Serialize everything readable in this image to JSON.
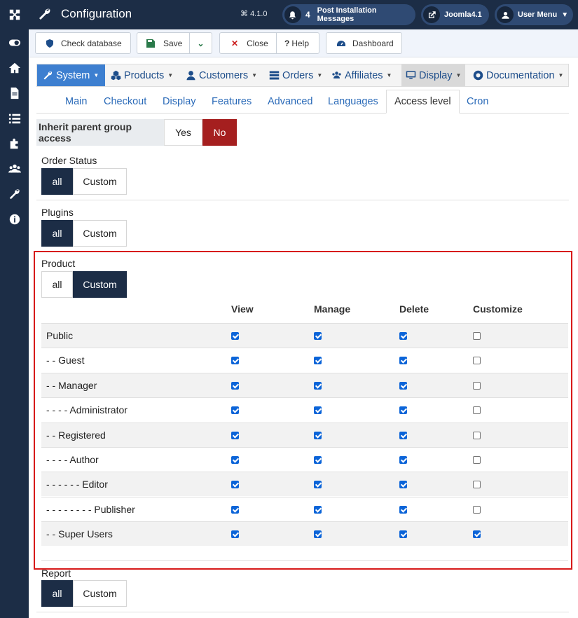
{
  "header": {
    "title": "Configuration",
    "version": "4.1.0",
    "notifications_count": "4",
    "post_install_label": "Post Installation Messages",
    "site_link_label": "Joomla4.1",
    "user_menu_label": "User Menu"
  },
  "toolbar": {
    "check_db": "Check database",
    "save": "Save",
    "close": "Close",
    "help": "Help",
    "dashboard": "Dashboard"
  },
  "menubar": {
    "items": [
      {
        "label": "System",
        "icon": "wrench-icon"
      },
      {
        "label": "Products",
        "icon": "cubes-icon"
      },
      {
        "label": "Customers",
        "icon": "user-icon"
      },
      {
        "label": "Orders",
        "icon": "list-icon"
      },
      {
        "label": "Affiliates",
        "icon": "users-icon"
      },
      {
        "label": "Display",
        "icon": "monitor-icon"
      },
      {
        "label": "Documentation",
        "icon": "lifebuoy-icon"
      }
    ]
  },
  "tabs": [
    "Main",
    "Checkout",
    "Display",
    "Features",
    "Advanced",
    "Languages",
    "Access level",
    "Cron"
  ],
  "inherit": {
    "label": "Inherit parent group access",
    "yes": "Yes",
    "no": "No",
    "selected": "No"
  },
  "sections": {
    "order_status": {
      "label": "Order Status",
      "all": "all",
      "custom": "Custom",
      "selected": "all"
    },
    "plugins": {
      "label": "Plugins",
      "all": "all",
      "custom": "Custom",
      "selected": "all"
    },
    "product": {
      "label": "Product",
      "all": "all",
      "custom": "Custom",
      "selected": "Custom"
    },
    "report": {
      "label": "Report",
      "all": "all",
      "custom": "Custom",
      "selected": "all"
    }
  },
  "permissions": {
    "columns": [
      "View",
      "Manage",
      "Delete",
      "Customize"
    ],
    "rows": [
      {
        "label": "Public",
        "view": true,
        "manage": true,
        "delete": true,
        "customize": false
      },
      {
        "label": "- - Guest",
        "view": true,
        "manage": true,
        "delete": true,
        "customize": false
      },
      {
        "label": "- - Manager",
        "view": true,
        "manage": true,
        "delete": true,
        "customize": false
      },
      {
        "label": "- - - - Administrator",
        "view": true,
        "manage": true,
        "delete": true,
        "customize": false
      },
      {
        "label": "- - Registered",
        "view": true,
        "manage": true,
        "delete": true,
        "customize": false
      },
      {
        "label": "- - - - Author",
        "view": true,
        "manage": true,
        "delete": true,
        "customize": false
      },
      {
        "label": "- - - - - - Editor",
        "view": true,
        "manage": true,
        "delete": true,
        "customize": false
      },
      {
        "label": "- - - - - - - - Publisher",
        "view": true,
        "manage": true,
        "delete": true,
        "customize": false
      },
      {
        "label": "- - Super Users",
        "view": true,
        "manage": true,
        "delete": true,
        "customize": true
      }
    ]
  },
  "colors": {
    "sidebar": "#1c2d46",
    "accent": "#3d7fd0",
    "no_active": "#a51f1f",
    "highlight": "#d71a1a"
  }
}
